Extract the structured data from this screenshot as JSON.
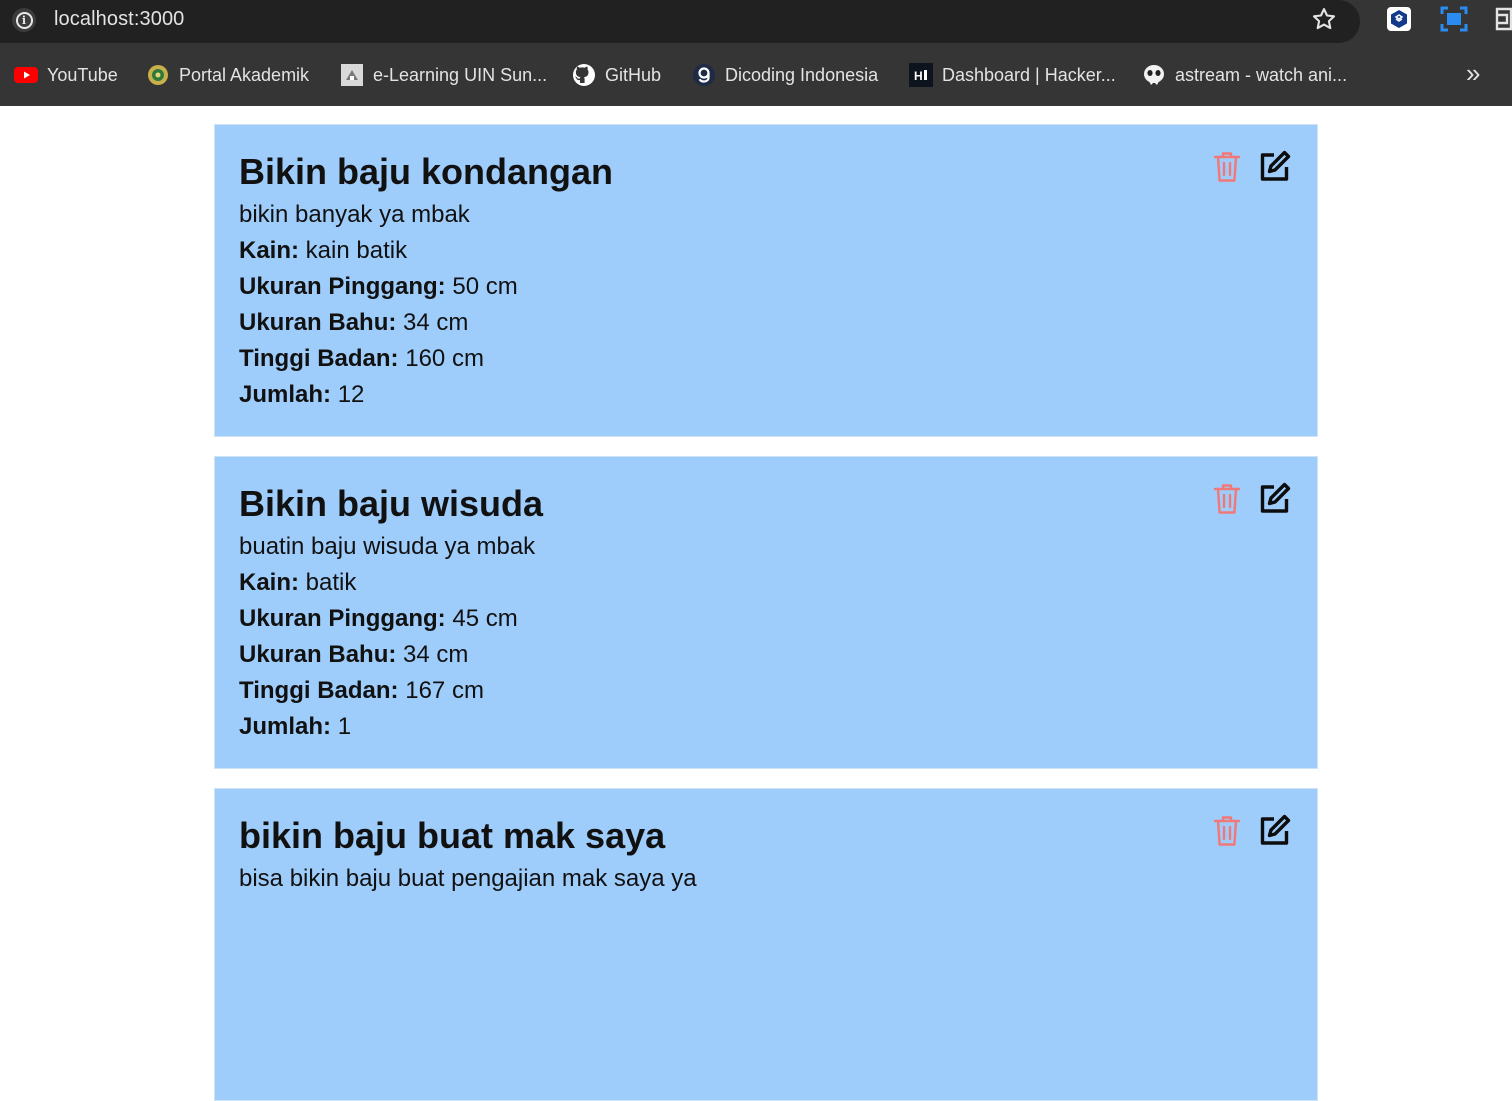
{
  "browser": {
    "url": "localhost:3000",
    "bookmarks": [
      {
        "label": "YouTube",
        "icon": "youtube-icon"
      },
      {
        "label": "Portal Akademik",
        "icon": "uin-logo-icon"
      },
      {
        "label": "e-Learning UIN Sun...",
        "icon": "elearning-icon"
      },
      {
        "label": "GitHub",
        "icon": "github-icon"
      },
      {
        "label": "Dicoding Indonesia",
        "icon": "dicoding-icon"
      },
      {
        "label": "Dashboard | Hacker...",
        "icon": "hackerrank-icon"
      },
      {
        "label": "astream - watch ani...",
        "icon": "astream-icon"
      }
    ]
  },
  "orders": [
    {
      "title": "Bikin baju kondangan",
      "description": "bikin banyak ya mbak",
      "fields": [
        {
          "label": "Kain:",
          "value": "kain batik"
        },
        {
          "label": "Ukuran Pinggang:",
          "value": "50 cm"
        },
        {
          "label": "Ukuran Bahu:",
          "value": "34 cm"
        },
        {
          "label": "Tinggi Badan:",
          "value": "160 cm"
        },
        {
          "label": "Jumlah:",
          "value": "12"
        }
      ]
    },
    {
      "title": "Bikin baju wisuda",
      "description": "buatin baju wisuda ya mbak",
      "fields": [
        {
          "label": "Kain:",
          "value": "batik"
        },
        {
          "label": "Ukuran Pinggang:",
          "value": "45 cm"
        },
        {
          "label": "Ukuran Bahu:",
          "value": "34 cm"
        },
        {
          "label": "Tinggi Badan:",
          "value": "167 cm"
        },
        {
          "label": "Jumlah:",
          "value": "1"
        }
      ]
    },
    {
      "title": "bikin baju buat mak saya",
      "description": "bisa bikin baju buat pengajian mak saya ya",
      "fields": []
    }
  ],
  "colors": {
    "card_bg": "#9fcdfb",
    "trash": "#f07878",
    "chrome_bg": "#353535",
    "urlbar_bg": "#212121"
  }
}
